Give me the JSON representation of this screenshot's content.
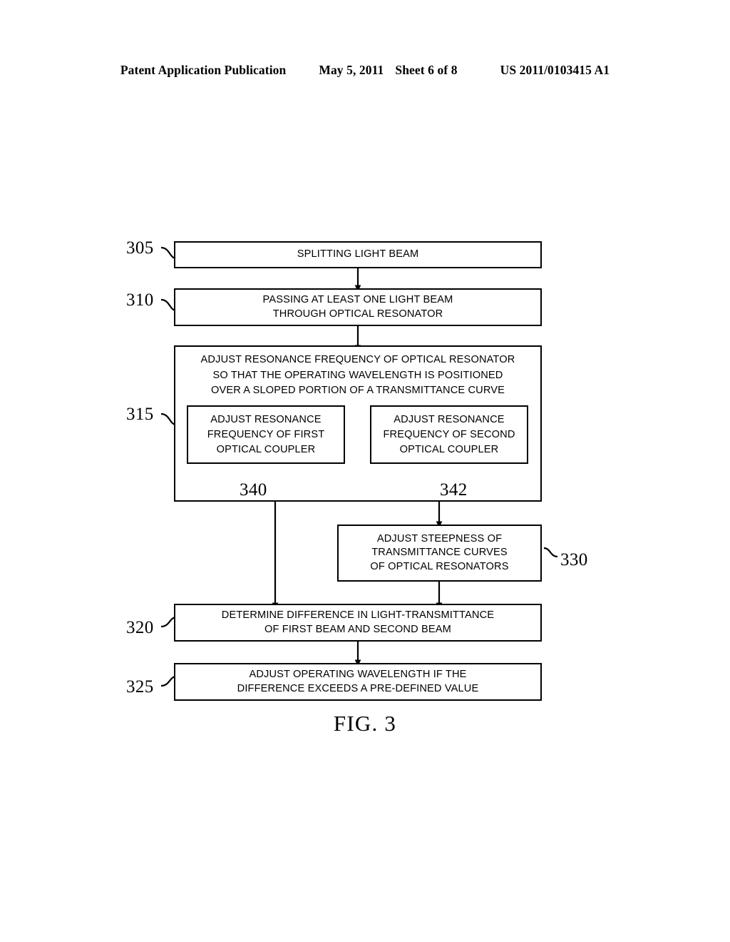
{
  "header": {
    "publication": "Patent Application Publication",
    "date": "May 5, 2011",
    "sheet": "Sheet 6 of 8",
    "number": "US 2011/0103415 A1"
  },
  "figure": {
    "caption": "FIG. 3"
  },
  "flowchart": {
    "steps": [
      {
        "ref": "305",
        "lines": [
          "SPLITTING LIGHT BEAM"
        ]
      },
      {
        "ref": "310",
        "lines": [
          "PASSING AT LEAST ONE LIGHT BEAM",
          "THROUGH OPTICAL RESONATOR"
        ]
      },
      {
        "ref": "315",
        "lines": [
          "ADJUST RESONANCE FREQUENCY OF OPTICAL RESONATOR",
          "SO THAT THE OPERATING WAVELENGTH IS POSITIONED",
          "OVER A SLOPED PORTION OF A TRANSMITTANCE CURVE"
        ],
        "substeps": [
          {
            "ref": "340",
            "lines": [
              "ADJUST RESONANCE",
              "FREQUENCY OF FIRST",
              "OPTICAL COUPLER"
            ]
          },
          {
            "ref": "342",
            "lines": [
              "ADJUST RESONANCE",
              "FREQUENCY OF SECOND",
              "OPTICAL COUPLER"
            ]
          }
        ]
      },
      {
        "ref": "330",
        "lines": [
          "ADJUST STEEPNESS OF",
          "TRANSMITTANCE CURVES",
          "OF OPTICAL RESONATORS"
        ]
      },
      {
        "ref": "320",
        "lines": [
          "DETERMINE DIFFERENCE IN LIGHT-TRANSMITTANCE",
          "OF FIRST BEAM AND SECOND BEAM"
        ]
      },
      {
        "ref": "325",
        "lines": [
          "ADJUST OPERATING WAVELENGTH IF THE",
          "DIFFERENCE EXCEEDS A PRE-DEFINED VALUE"
        ]
      }
    ]
  }
}
